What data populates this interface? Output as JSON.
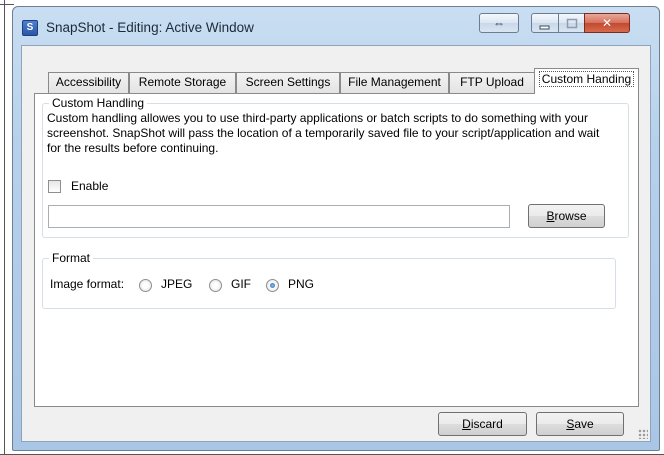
{
  "window": {
    "title": "SnapShot - Editing: Active Window",
    "app_icon_letter": "S",
    "swap_glyph": "⇔",
    "close_glyph": "✕"
  },
  "tabs": [
    {
      "label": "Accessibility"
    },
    {
      "label": "Remote Storage"
    },
    {
      "label": "Screen Settings"
    },
    {
      "label": "File Management"
    },
    {
      "label": "FTP Upload"
    },
    {
      "label": "Custom Handing"
    }
  ],
  "custom_handling": {
    "group_title": "Custom Handling",
    "description": "Custom handling allowes you to use third-party applications or batch scripts to do something with your screenshot. SnapShot will pass the location of a temporarily saved file to your script/application and wait for the results before continuing.",
    "enable_label": "Enable",
    "enable_checked": false,
    "path_value": "",
    "browse_label_first": "B",
    "browse_label_rest": "rowse"
  },
  "format": {
    "group_title": "Format",
    "image_format_label": "Image format:",
    "options": [
      {
        "label": "JPEG",
        "checked": false
      },
      {
        "label": "GIF",
        "checked": false
      },
      {
        "label": "PNG",
        "checked": true
      }
    ]
  },
  "footer": {
    "discard_first": "D",
    "discard_rest": "iscard",
    "save_first": "S",
    "save_rest": "ave"
  }
}
